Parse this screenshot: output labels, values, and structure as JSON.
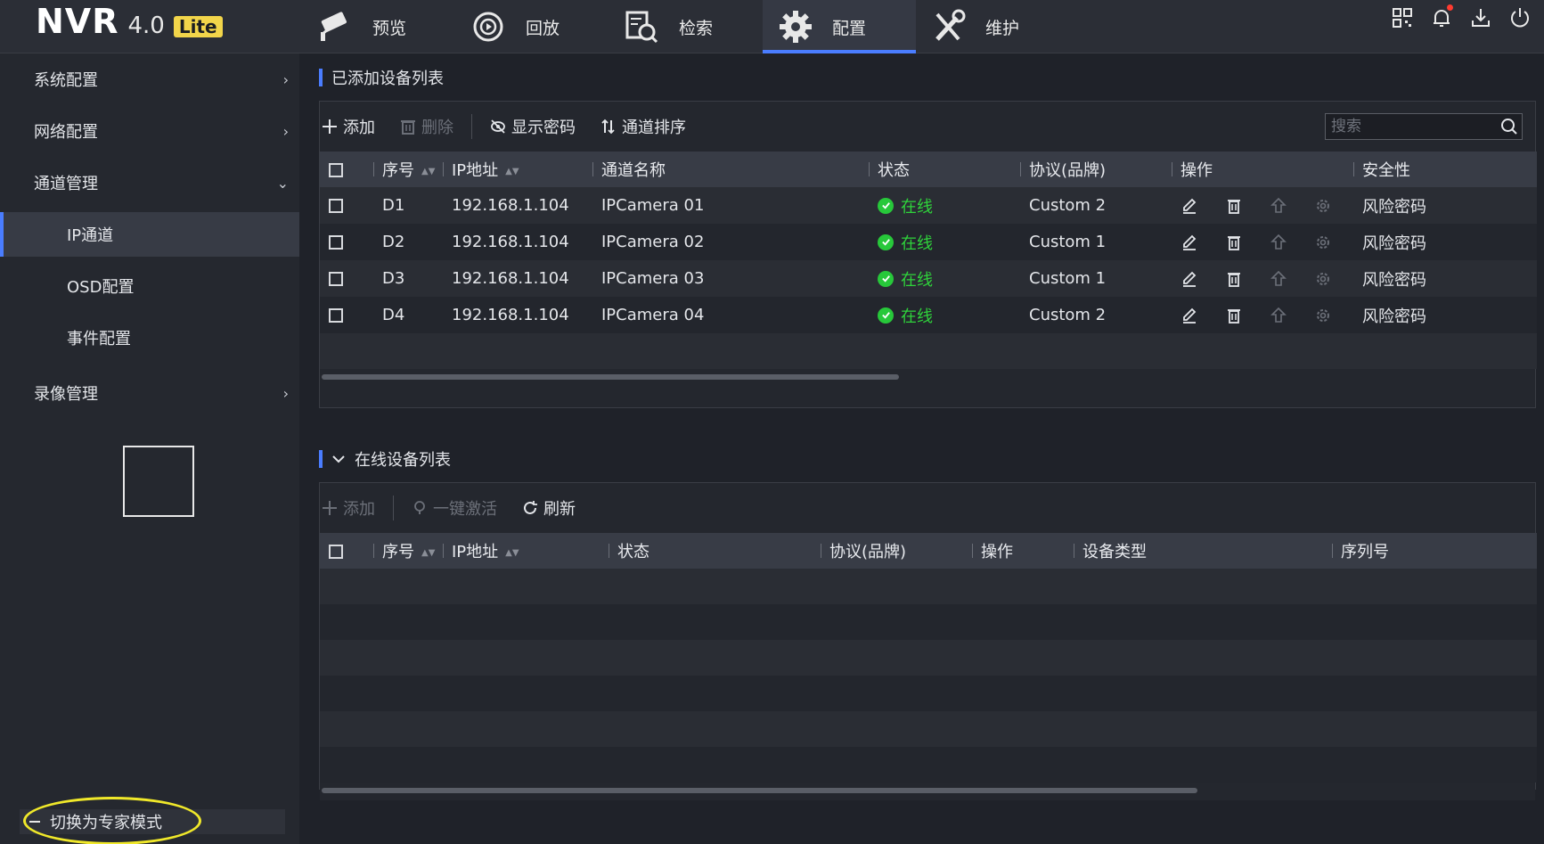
{
  "app": {
    "logo_main": "NVR",
    "logo_version": "4.0",
    "logo_badge": "Lite"
  },
  "nav": [
    {
      "label": "预览",
      "icon": "camera-icon"
    },
    {
      "label": "回放",
      "icon": "playback-icon"
    },
    {
      "label": "检索",
      "icon": "search-doc-icon"
    },
    {
      "label": "配置",
      "icon": "gear-icon",
      "active": true
    },
    {
      "label": "维护",
      "icon": "tools-icon"
    }
  ],
  "sidebar": {
    "items": [
      {
        "label": "系统配置",
        "chevron": "›"
      },
      {
        "label": "网络配置",
        "chevron": "›"
      },
      {
        "label": "通道管理",
        "chevron": "⌄"
      },
      {
        "label": "IP通道"
      },
      {
        "label": "OSD配置"
      },
      {
        "label": "事件配置"
      },
      {
        "label": "录像管理",
        "chevron": "›"
      }
    ],
    "expert_mode": "切换为专家模式"
  },
  "added_list": {
    "title": "已添加设备列表",
    "toolbar": {
      "add": "添加",
      "delete": "删除",
      "show_password": "显示密码",
      "channel_sort": "通道排序"
    },
    "search_placeholder": "搜索",
    "columns": [
      "序号",
      "IP地址",
      "通道名称",
      "状态",
      "协议(品牌)",
      "操作",
      "安全性"
    ],
    "rows": [
      {
        "id": "D1",
        "ip": "192.168.1.104",
        "name": "IPCamera 01",
        "status": "在线",
        "protocol": "Custom 2",
        "security": "风险密码"
      },
      {
        "id": "D2",
        "ip": "192.168.1.104",
        "name": "IPCamera 02",
        "status": "在线",
        "protocol": "Custom 1",
        "security": "风险密码"
      },
      {
        "id": "D3",
        "ip": "192.168.1.104",
        "name": "IPCamera 03",
        "status": "在线",
        "protocol": "Custom 1",
        "security": "风险密码"
      },
      {
        "id": "D4",
        "ip": "192.168.1.104",
        "name": "IPCamera 04",
        "status": "在线",
        "protocol": "Custom 2",
        "security": "风险密码"
      }
    ]
  },
  "online_list": {
    "title": "在线设备列表",
    "toolbar": {
      "add": "添加",
      "activate": "一键激活",
      "refresh": "刷新"
    },
    "columns": [
      "序号",
      "IP地址",
      "状态",
      "协议(品牌)",
      "操作",
      "设备类型",
      "序列号"
    ]
  },
  "colors": {
    "accent": "#4a7dff",
    "online": "#2fd33b",
    "highlight_ellipse": "#f0e82a"
  }
}
